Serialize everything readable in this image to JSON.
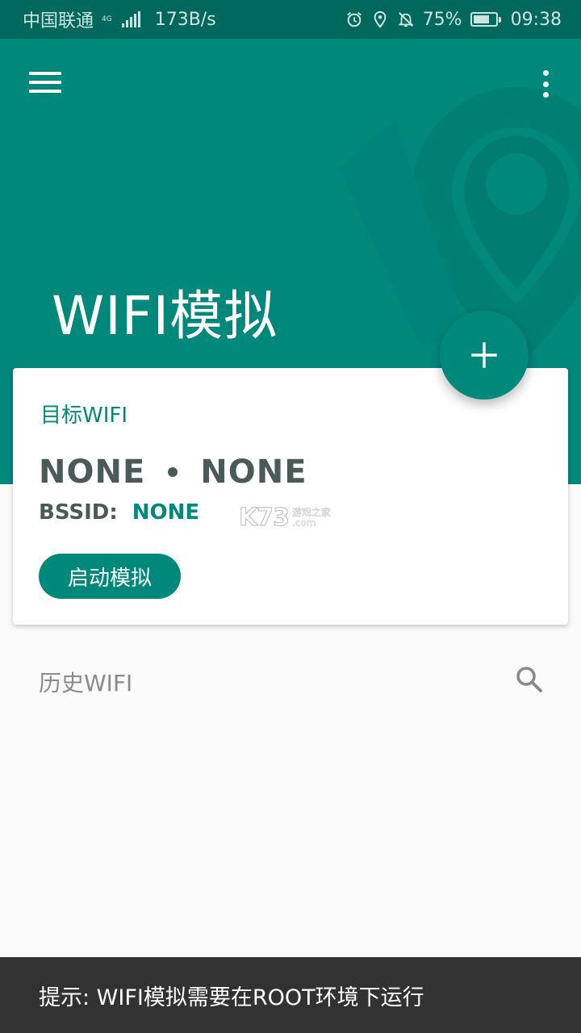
{
  "status_bar": {
    "carrier": "中国联通",
    "network_type": "4G",
    "speed": "173B/s",
    "battery": "75%",
    "battery_level": 0.75,
    "time": "09:38"
  },
  "header": {
    "title": "WIFI模拟",
    "menu_icon": "menu-icon",
    "more_icon": "more-vert-icon",
    "color": "#00897b"
  },
  "fab": {
    "icon": "plus-icon"
  },
  "card": {
    "label": "目标WIFI",
    "ssid": "NONE",
    "ssid_secondary": "NONE",
    "bssid_key": "BSSID:",
    "bssid_value": "NONE",
    "start_button": "启动模拟"
  },
  "watermark": {
    "logo": "K73",
    "sub_top": "游戏之家",
    "sub_bottom": ".com"
  },
  "history": {
    "label": "历史WIFI",
    "search_icon": "search-icon"
  },
  "snackbar": {
    "message": "提示: WIFI模拟需要在ROOT环境下运行"
  }
}
